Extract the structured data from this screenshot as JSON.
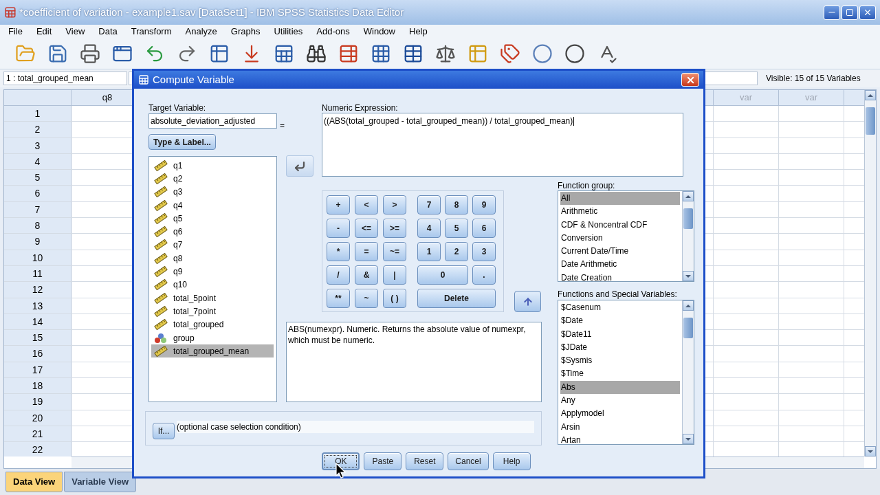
{
  "window": {
    "title": "*coefficient of variation - example1.sav [DataSet1] - IBM SPSS Statistics Data Editor"
  },
  "menu": [
    "File",
    "Edit",
    "View",
    "Data",
    "Transform",
    "Analyze",
    "Graphs",
    "Utilities",
    "Add-ons",
    "Window",
    "Help"
  ],
  "cell_ref": "1 : total_grouped_mean",
  "visible_vars": "Visible: 15 of 15 Variables",
  "grid": {
    "left_column": "q8",
    "right_columns": [
      "var",
      "var"
    ],
    "rows": [
      "1",
      "2",
      "3",
      "4",
      "5",
      "6",
      "7",
      "8",
      "9",
      "10",
      "11",
      "12",
      "13",
      "14",
      "15",
      "16",
      "17",
      "18",
      "19",
      "20",
      "21",
      "22"
    ]
  },
  "view_tabs": [
    {
      "label": "Data View",
      "selected": true
    },
    {
      "label": "Variable View",
      "selected": false
    }
  ],
  "dialog": {
    "title": "Compute Variable",
    "target_label": "Target Variable:",
    "target_value": "absolute_deviation_adjusted",
    "equals": "=",
    "type_label_button": "Type & Label...",
    "variables": [
      {
        "name": "q1",
        "kind": "scale",
        "selected": false
      },
      {
        "name": "q2",
        "kind": "scale",
        "selected": false
      },
      {
        "name": "q3",
        "kind": "scale",
        "selected": false
      },
      {
        "name": "q4",
        "kind": "scale",
        "selected": false
      },
      {
        "name": "q5",
        "kind": "scale",
        "selected": false
      },
      {
        "name": "q6",
        "kind": "scale",
        "selected": false
      },
      {
        "name": "q7",
        "kind": "scale",
        "selected": false
      },
      {
        "name": "q8",
        "kind": "scale",
        "selected": false
      },
      {
        "name": "q9",
        "kind": "scale",
        "selected": false
      },
      {
        "name": "q10",
        "kind": "scale",
        "selected": false
      },
      {
        "name": "total_5point",
        "kind": "scale",
        "selected": false
      },
      {
        "name": "total_7point",
        "kind": "scale",
        "selected": false
      },
      {
        "name": "total_grouped",
        "kind": "scale",
        "selected": false
      },
      {
        "name": "group",
        "kind": "nominal",
        "selected": false
      },
      {
        "name": "total_grouped_mean",
        "kind": "scale",
        "selected": true
      }
    ],
    "expression_label": "Numeric Expression:",
    "expression": "((ABS(total_grouped - total_grouped_mean)) / total_grouped_mean)",
    "operators": [
      "+",
      "<",
      ">",
      "-",
      "<=",
      ">=",
      "*",
      "=",
      "~=",
      "/",
      "&",
      "|",
      "**",
      "~",
      "( )"
    ],
    "digits": [
      {
        "label": "7",
        "kind": "single"
      },
      {
        "label": "8",
        "kind": "single"
      },
      {
        "label": "9",
        "kind": "single"
      },
      {
        "label": "4",
        "kind": "single"
      },
      {
        "label": "5",
        "kind": "single"
      },
      {
        "label": "6",
        "kind": "single"
      },
      {
        "label": "1",
        "kind": "single"
      },
      {
        "label": "2",
        "kind": "single"
      },
      {
        "label": "3",
        "kind": "single"
      },
      {
        "label": "0",
        "kind": "double"
      },
      {
        "label": ".",
        "kind": "single"
      },
      {
        "label": "Delete",
        "kind": "triple"
      }
    ],
    "description": "ABS(numexpr). Numeric. Returns the absolute value of numexpr, which must be numeric.",
    "function_group_label": "Function group:",
    "function_groups": [
      {
        "label": "All",
        "selected": true
      },
      {
        "label": "Arithmetic",
        "selected": false
      },
      {
        "label": "CDF & Noncentral CDF",
        "selected": false
      },
      {
        "label": "Conversion",
        "selected": false
      },
      {
        "label": "Current Date/Time",
        "selected": false
      },
      {
        "label": "Date Arithmetic",
        "selected": false
      },
      {
        "label": "Date Creation",
        "selected": false
      }
    ],
    "functions_label": "Functions and Special Variables:",
    "functions": [
      {
        "label": "$Casenum",
        "selected": false
      },
      {
        "label": "$Date",
        "selected": false
      },
      {
        "label": "$Date11",
        "selected": false
      },
      {
        "label": "$JDate",
        "selected": false
      },
      {
        "label": "$Sysmis",
        "selected": false
      },
      {
        "label": "$Time",
        "selected": false
      },
      {
        "label": "Abs",
        "selected": true
      },
      {
        "label": "Any",
        "selected": false
      },
      {
        "label": "Applymodel",
        "selected": false
      },
      {
        "label": "Arsin",
        "selected": false
      },
      {
        "label": "Artan",
        "selected": false
      }
    ],
    "if_button": "If...",
    "if_condition": "(optional case selection condition)",
    "buttons": [
      {
        "label": "OK",
        "focused": true
      },
      {
        "label": "Paste",
        "focused": false
      },
      {
        "label": "Reset",
        "focused": false
      },
      {
        "label": "Cancel",
        "focused": false
      },
      {
        "label": "Help",
        "focused": false
      }
    ]
  }
}
